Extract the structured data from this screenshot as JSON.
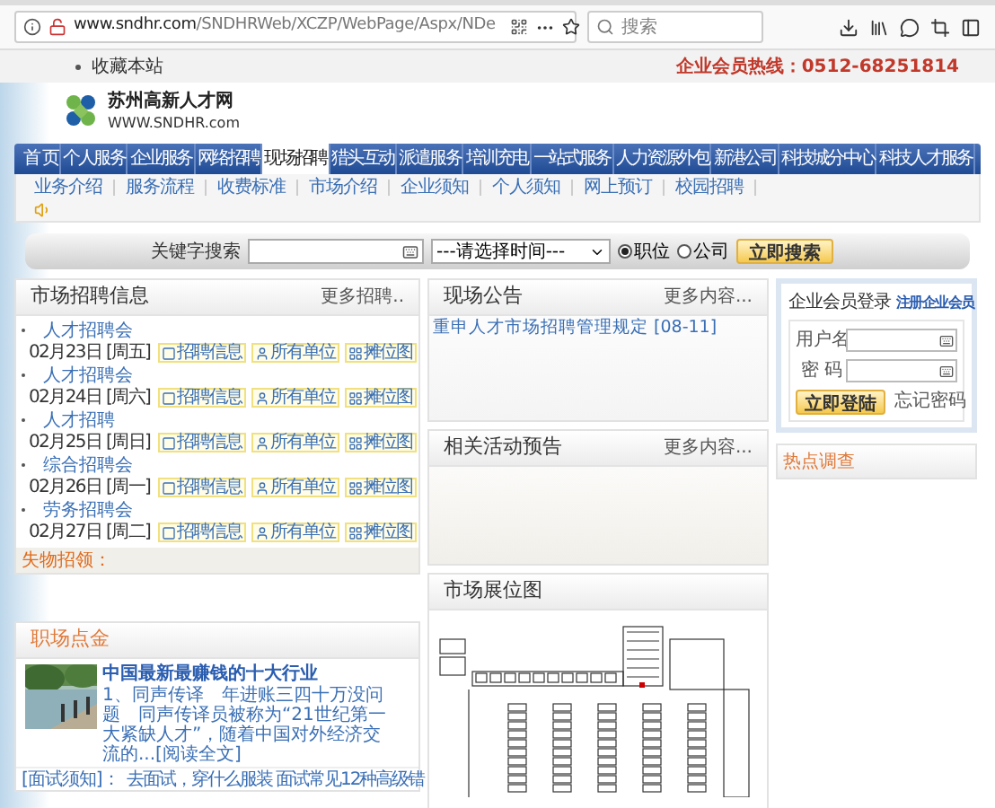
{
  "browser": {
    "url_host": "www.sndhr.com",
    "url_path": "/SNDHRWeb/XCZP/WebPage/Aspx/NDe",
    "search": {
      "placeholder": "搜索"
    }
  },
  "top_bar": {
    "bookmark": "收藏本站",
    "hotline": "企业会员热线：0512-68251814"
  },
  "logo": {
    "name": "苏州高新人才网",
    "url": "WWW.SNDHR.com"
  },
  "nav": [
    {
      "label": "首 页",
      "selected": false
    },
    {
      "label": "个人服务",
      "selected": false
    },
    {
      "label": "企业服务",
      "selected": false
    },
    {
      "label": "网络招聘",
      "selected": false
    },
    {
      "label": "现场招聘",
      "selected": true
    },
    {
      "label": "猎头互动",
      "selected": false
    },
    {
      "label": "派遣服务",
      "selected": false
    },
    {
      "label": "培训充电",
      "selected": false
    },
    {
      "label": "一站式服务",
      "selected": false
    },
    {
      "label": "人力资源外包",
      "selected": false
    },
    {
      "label": "新港公司",
      "selected": false
    },
    {
      "label": "科技城分中心",
      "selected": false
    },
    {
      "label": "科技人才服务",
      "selected": false
    }
  ],
  "subnav": [
    "业务介绍",
    "服务流程",
    "收费标准",
    "市场介绍",
    "企业须知",
    "个人须知",
    "网上预订",
    "校园招聘"
  ],
  "search": {
    "label": "关键字搜索",
    "time_select": "---请选择时间---",
    "radios": [
      {
        "label": "职位",
        "selected": true
      },
      {
        "label": "公司",
        "selected": false
      }
    ],
    "button": "立即搜索"
  },
  "market": {
    "title": "市场招聘信息",
    "more": "更多招聘..",
    "fairs": [
      {
        "name": "人才招聘会",
        "date": "02月23日 [周五]",
        "links": [
          "招聘信息",
          "所有单位",
          "摊位图"
        ]
      },
      {
        "name": "人才招聘会",
        "date": "02月24日 [周六]",
        "links": [
          "招聘信息",
          "所有单位",
          "摊位图"
        ]
      },
      {
        "name": "人才招聘",
        "date": "02月25日 [周日]",
        "links": [
          "招聘信息",
          "所有单位",
          "摊位图"
        ]
      },
      {
        "name": "综合招聘会",
        "date": "02月26日 [周一]",
        "links": [
          "招聘信息",
          "所有单位",
          "摊位图"
        ]
      },
      {
        "name": "劳务招聘会",
        "date": "02月27日 [周二]",
        "links": [
          "招聘信息",
          "所有单位",
          "摊位图"
        ]
      }
    ],
    "lost_found": "失物招领："
  },
  "notice": {
    "title": "现场公告",
    "more": "更多内容...",
    "items": [
      "重申人才市场招聘管理规定 [08-11]"
    ]
  },
  "events": {
    "title": "相关活动预告",
    "more": "更多内容..."
  },
  "login": {
    "title": "企业会员登录",
    "register": "注册企业会员",
    "username_label": "用户名",
    "password_label": "密 码",
    "button": "立即登陆",
    "forgot": "忘记密码"
  },
  "hot_survey": {
    "title": "热点调查"
  },
  "career": {
    "title": "职场点金",
    "article_title": "中国最新最赚钱的十大行业",
    "article_body": "1、同声传译　年进账三四十万没问题　同声传译员被称为“21世纪第一大紧缺人才”，随着中国对外经济交流的...[阅读全文]",
    "tip_label": "[面试须知]：",
    "tip": "去面试，穿什么服装  面试常见12种高级错"
  },
  "booth_map": {
    "title": "市场展位图"
  }
}
